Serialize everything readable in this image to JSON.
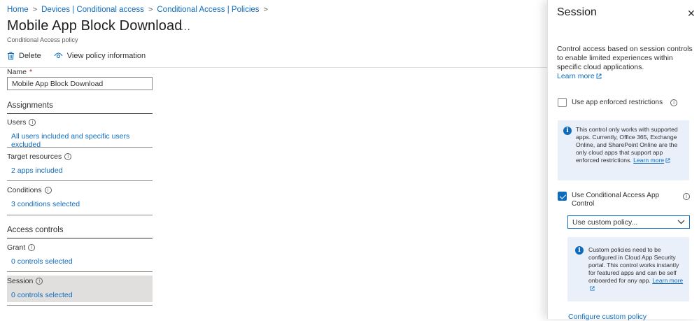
{
  "breadcrumb": {
    "items": [
      "Home",
      "Devices | Conditional access",
      "Conditional Access | Policies"
    ],
    "separator": ">"
  },
  "page": {
    "title": "Mobile App Block Download",
    "more_label": "...",
    "subtitle": "Conditional Access policy"
  },
  "toolbar": {
    "delete_label": "Delete",
    "view_info_label": "View policy information"
  },
  "form": {
    "name_label": "Name",
    "required_mark": "*",
    "name_value": "Mobile App Block Download",
    "assignments_heading": "Assignments",
    "users_label": "Users",
    "users_value": "All users included and specific users excluded",
    "target_label": "Target resources",
    "target_value": "2 apps included",
    "conditions_label": "Conditions",
    "conditions_value": "3 conditions selected",
    "access_heading": "Access controls",
    "grant_label": "Grant",
    "grant_value": "0 controls selected",
    "session_label": "Session",
    "session_value": "0 controls selected"
  },
  "panel": {
    "title": "Session",
    "close_symbol": "✕",
    "description": "Control access based on session controls to enable limited experiences within specific cloud applications.",
    "learn_more": "Learn more",
    "app_enforced": {
      "label": "Use app enforced restrictions",
      "checked": false
    },
    "info1_text": "This control only works with supported apps. Currently, Office 365, Exchange Online, and SharePoint Online are the only cloud apps that support app enforced restrictions.",
    "info1_link": "Learn more",
    "app_control": {
      "label": "Use Conditional Access App Control",
      "checked": true
    },
    "dropdown_value": "Use custom policy...",
    "info2_text": "Custom policies need to be configured in Cloud App Security portal. This control works instantly for featured apps and can be self onboarded for any app.",
    "info2_link": "Learn more",
    "configure_link": "Configure custom policy"
  },
  "colors": {
    "accent": "#0f6cbd",
    "info_background": "#e9f0fa",
    "selected_row": "#e1dfdd",
    "required": "#a4262c"
  }
}
